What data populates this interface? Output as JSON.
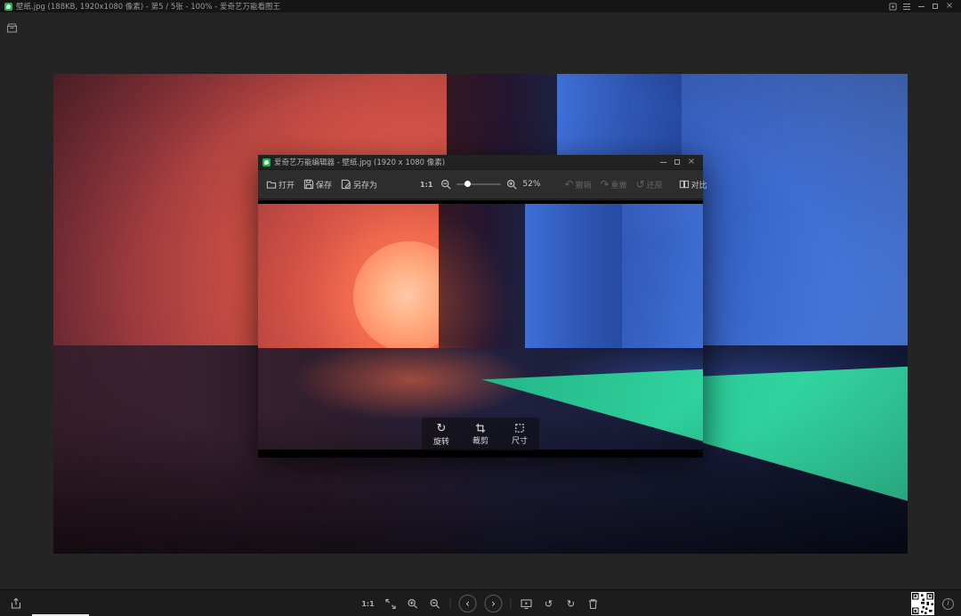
{
  "titlebar": {
    "title": "壁纸.jpg (188KB, 1920x1080 像素) - 第5 / 5张 - 100% - 爱奇艺万能看图王"
  },
  "editor": {
    "title": "爱奇艺万能编辑器 - 壁纸.jpg (1920 x 1080 像素)",
    "open": "打开",
    "save": "保存",
    "save_as": "另存为",
    "one_to_one": "1:1",
    "zoom_value": "52%",
    "undo": "撤销",
    "redo": "重做",
    "restore": "还原",
    "compare": "对比",
    "float_tools": [
      {
        "label": "旋转",
        "icon": "rotate-icon"
      },
      {
        "label": "裁剪",
        "icon": "crop-icon"
      },
      {
        "label": "尺寸",
        "icon": "resize-icon"
      }
    ]
  },
  "bottombar": {
    "one_to_one": "1:1"
  },
  "glyphs": {
    "undo": "↶",
    "redo": "↷",
    "restore": "↺",
    "rotate": "↻",
    "rotate_left": "↺",
    "rotate_right": "↻",
    "prev": "‹",
    "next": "›",
    "close": "×",
    "info": "i"
  },
  "colors": {
    "accent_green": "#1cb84e",
    "wall_red": "#cd4f44",
    "sun": "#ffa077",
    "wall_blue": "#3d6bd0",
    "floor_green": "#2ecf9b",
    "titlebar_bg": "#151515",
    "toolbar_bg": "#2d2d2d"
  }
}
